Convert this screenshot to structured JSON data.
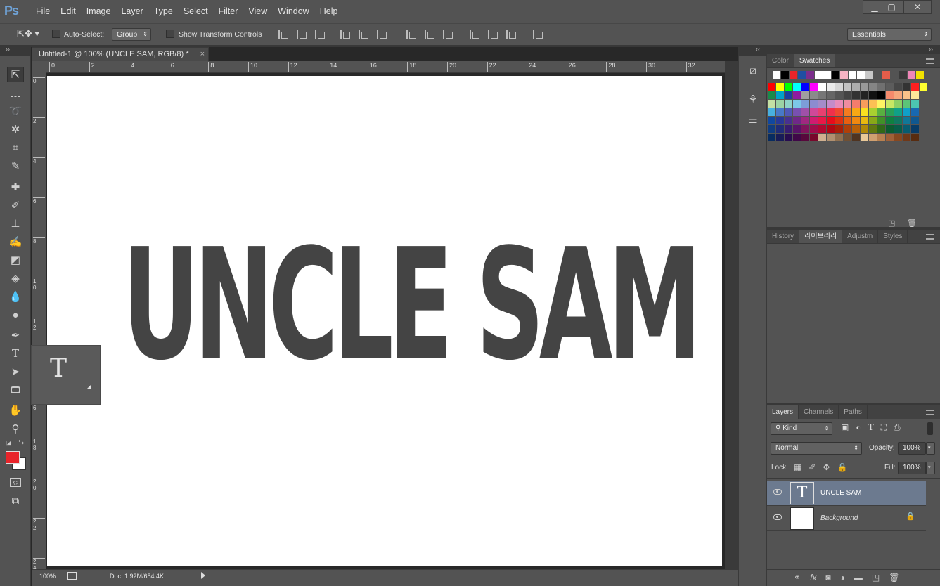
{
  "app": {
    "logo": "Ps"
  },
  "menu": [
    "File",
    "Edit",
    "Image",
    "Layer",
    "Type",
    "Select",
    "Filter",
    "View",
    "Window",
    "Help"
  ],
  "window_controls": [
    "▁",
    "▢",
    "✕"
  ],
  "options_bar": {
    "auto_select_label": "Auto-Select:",
    "auto_select_value": "Group",
    "transform_label": "Show Transform Controls",
    "workspace": "Essentials"
  },
  "document": {
    "tab_title": "Untitled-1 @ 100% (UNCLE SAM, RGB/8) *",
    "tab_close": "×",
    "canvas_text": "UNCLE SAM",
    "ruler_h": [
      "0",
      "2",
      "4",
      "6",
      "8",
      "10",
      "12",
      "14",
      "16",
      "18",
      "20",
      "22",
      "24",
      "26",
      "28",
      "30",
      "32"
    ],
    "ruler_v": [
      "0",
      "2",
      "4",
      "6",
      "8",
      "1\n0",
      "1\n2",
      "1\n4",
      "1\n6",
      "1\n8",
      "2\n0",
      "2\n2",
      "2\n4"
    ]
  },
  "status": {
    "zoom": "100%",
    "doc": "Doc: 1.92M/654.4K"
  },
  "tooltip": {
    "icon": "T"
  },
  "colors": {
    "foreground": "#e8242a",
    "background": "#ffffff",
    "canvas_text": "#444444",
    "layer_selected": "#6c7a8f"
  },
  "panels": {
    "color_tabs": [
      "Color",
      "Swatches"
    ],
    "history_tabs": [
      "History",
      "라이브러리",
      "Adjustm",
      "Styles"
    ],
    "layers_tabs": [
      "Layers",
      "Channels",
      "Paths"
    ],
    "filter_kind": "Kind",
    "blend_mode": "Normal",
    "opacity_label": "Opacity:",
    "opacity_value": "100%",
    "lock_label": "Lock:",
    "fill_label": "Fill:",
    "fill_value": "100%",
    "layers": [
      {
        "name": "UNCLE SAM",
        "thumb": "T"
      },
      {
        "name": "Background"
      }
    ],
    "layers_footer_icons": [
      "link-icon",
      "fx-icon",
      "mask-icon",
      "adjustment-icon",
      "folder-icon",
      "new-layer-icon",
      "trash-icon"
    ]
  },
  "swatches": {
    "row0": [
      "#ffffff",
      "#000000",
      "#e8242a",
      "#1f4fa2",
      "#7b2d8c",
      "#ffffff",
      "#ffffff",
      "#000000",
      "#f7b4c4",
      "#ffffff",
      "#ffffff",
      "#c8c8c8",
      "#535353",
      "#e55d4a",
      "#535353",
      "#3a3a3a",
      "#ef86b8",
      "#f1e100"
    ],
    "rows": [
      [
        "#ff0000",
        "#ffff00",
        "#00ff00",
        "#00ffff",
        "#0000ff",
        "#ff00ff",
        "#ffffff",
        "#ebebeb",
        "#d6d6d6",
        "#c2c2c2",
        "#adadad",
        "#999999",
        "#858585",
        "#707070",
        "#5c5c5c",
        "#474747",
        "#333333",
        "#ff2020",
        "#ffff30"
      ],
      [
        "#1a8a4a",
        "#00a2c8",
        "#1a3fa0",
        "#8e1ca0",
        "#a0a0a0",
        "#8a8a8a",
        "#777777",
        "#666666",
        "#555555",
        "#444444",
        "#333333",
        "#222222",
        "#111111",
        "#000000",
        "#f58a6c",
        "#f5a77c",
        "#f9c28a",
        "#fde69a"
      ],
      [
        "#c4e0a4",
        "#9cd3a4",
        "#8fd3c8",
        "#7cc8e8",
        "#7c9ed8",
        "#8c8cd0",
        "#a48cc8",
        "#c48cc8",
        "#e88cb8",
        "#f08ca0",
        "#f47c6c",
        "#f89c5c",
        "#fcc054",
        "#fef464",
        "#c8e864",
        "#8cd064",
        "#5cc478",
        "#4cc4b0"
      ],
      [
        "#48b0e0",
        "#4878c8",
        "#5058b8",
        "#7850b0",
        "#a050a8",
        "#d04898",
        "#e84070",
        "#f0304c",
        "#f04830",
        "#f47c20",
        "#f8a814",
        "#f8e020",
        "#a8d030",
        "#58b040",
        "#28a058",
        "#10a088",
        "#10a0c8",
        "#1868b0"
      ],
      [
        "#1048a0",
        "#283898",
        "#483090",
        "#702888",
        "#a02880",
        "#d01c70",
        "#e81848",
        "#e80c1c",
        "#e03010",
        "#e86010",
        "#f08810",
        "#e8b810",
        "#88a818",
        "#409028",
        "#108040",
        "#107860",
        "#107898",
        "#105890"
      ],
      [
        "#103c80",
        "#202c78",
        "#381c70",
        "#581468",
        "#80145c",
        "#a00c4c",
        "#b00830",
        "#b00814",
        "#a82008",
        "#b04008",
        "#b86008",
        "#b08808",
        "#607810",
        "#306818",
        "#0c5c30",
        "#085c48",
        "#085c70",
        "#083c68"
      ],
      [
        "#082c60",
        "#181c58",
        "#280c50",
        "#400848",
        "#58083c",
        "#78082c",
        "#d0b090",
        "#b09070",
        "#907050",
        "#705034",
        "#503420",
        "#e8c898",
        "#d0a070",
        "#b88050",
        "#a06038",
        "#884820",
        "#703818",
        "#582c10"
      ]
    ]
  }
}
